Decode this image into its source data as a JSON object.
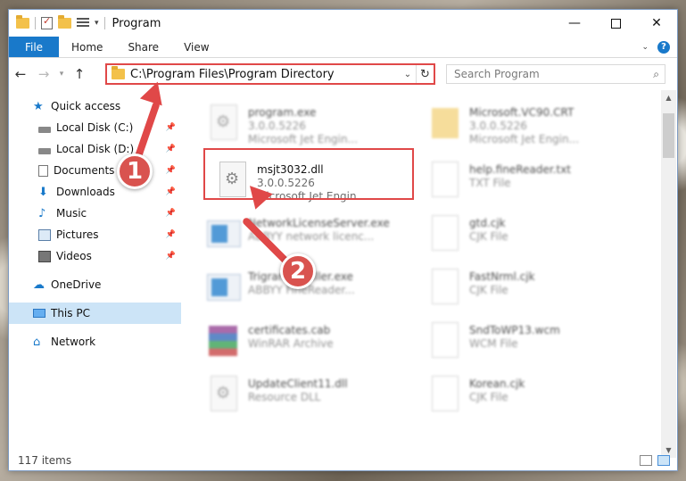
{
  "window": {
    "title": "Program",
    "minimize_glyph": "—",
    "close_glyph": "✕"
  },
  "ribbon": {
    "tabs": [
      "File",
      "Home",
      "Share",
      "View"
    ],
    "help_glyph": "?",
    "expand_glyph": "⌄"
  },
  "address": {
    "path": "C:\\Program Files\\Program Directory",
    "search_placeholder": "Search Program"
  },
  "nav": {
    "quick_access": "Quick access",
    "items": [
      {
        "label": "Local Disk (C:)"
      },
      {
        "label": "Local Disk (D:)"
      },
      {
        "label": "Documents"
      },
      {
        "label": "Downloads"
      },
      {
        "label": "Music"
      },
      {
        "label": "Pictures"
      },
      {
        "label": "Videos"
      }
    ],
    "onedrive": "OneDrive",
    "this_pc": "This PC",
    "network": "Network"
  },
  "files": [
    {
      "name": "program.exe",
      "line2": "3.0.0.5226",
      "line3": "Microsoft Jet Engin...",
      "icon": "gear"
    },
    {
      "name": "Microsoft.VC90.CRT",
      "line2": "3.0.0.5226",
      "line3": "Microsoft Jet Engin...",
      "icon": "folder"
    },
    {
      "name": "msjt3032.dll",
      "line2": "3.0.0.5226",
      "line3": "Microsoft Jet Engin...",
      "icon": "gear"
    },
    {
      "name": "help.fineReader.txt",
      "line2": "TXT File",
      "line3": "",
      "icon": "page"
    },
    {
      "name": "NetworkLicenseServer.exe",
      "line2": "ABBYY network licenc...",
      "line3": "",
      "icon": "app"
    },
    {
      "name": "gtd.cjk",
      "line2": "CJK File",
      "line3": "",
      "icon": "page"
    },
    {
      "name": "TrigramInstaller.exe",
      "line2": "ABBYY FineReader...",
      "line3": "",
      "icon": "app"
    },
    {
      "name": "FastNrml.cjk",
      "line2": "CJK File",
      "line3": "",
      "icon": "page"
    },
    {
      "name": "certificates.cab",
      "line2": "WinRAR Archive",
      "line3": "",
      "icon": "rar"
    },
    {
      "name": "SndToWP13.wcm",
      "line2": "WCM File",
      "line3": "",
      "icon": "page"
    },
    {
      "name": "UpdateClient11.dll",
      "line2": "Resource DLL",
      "line3": "",
      "icon": "gear"
    },
    {
      "name": "Korean.cjk",
      "line2": "CJK File",
      "line3": "",
      "icon": "page"
    }
  ],
  "status": {
    "item_count": "117 items"
  },
  "markers": {
    "one": "1",
    "two": "2"
  },
  "colors": {
    "accent": "#1979ca",
    "highlight": "#e04848",
    "selection": "#cce4f7"
  }
}
